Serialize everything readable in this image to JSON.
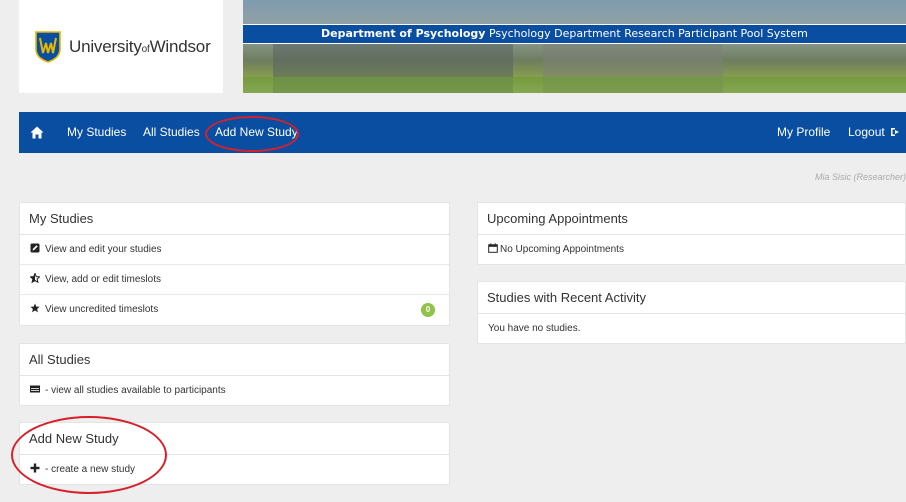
{
  "header": {
    "logo_main": "University",
    "logo_of": "of",
    "logo_name": "Windsor",
    "banner_bold": "Department of Psychology",
    "banner_text": " Psychology Department Research Participant Pool System"
  },
  "nav": {
    "home_icon": "home-icon",
    "my_studies": "My Studies",
    "all_studies": "All Studies",
    "add_new_study": "Add New Study",
    "my_profile": "My Profile",
    "logout": "Logout"
  },
  "user": {
    "label": "Mia Sisic (Researcher)"
  },
  "panels": {
    "my_studies": {
      "title": "My Studies",
      "items": [
        {
          "label": "View and edit your studies",
          "icon": "edit-icon"
        },
        {
          "label": "View, add or edit timeslots",
          "icon": "star-half-icon"
        },
        {
          "label": "View uncredited timeslots",
          "icon": "star-icon",
          "badge": "0"
        }
      ]
    },
    "all_studies": {
      "title": "All Studies",
      "items": [
        {
          "label": "- view all studies available to participants",
          "icon": "list-icon"
        }
      ]
    },
    "add_new_study": {
      "title": "Add New Study",
      "items": [
        {
          "label": "- create a new study",
          "icon": "plus-icon"
        }
      ]
    },
    "upcoming": {
      "title": "Upcoming Appointments",
      "items": [
        {
          "label": "No Upcoming Appointments",
          "icon": "calendar-icon"
        }
      ]
    },
    "recent": {
      "title": "Studies with Recent Activity",
      "items": [
        {
          "label": "You have no studies."
        }
      ]
    }
  },
  "colors": {
    "nav_bg": "#0a4ea2",
    "page_bg": "#eeeeee",
    "badge": "#91c24a",
    "annotation": "#d8202a"
  }
}
